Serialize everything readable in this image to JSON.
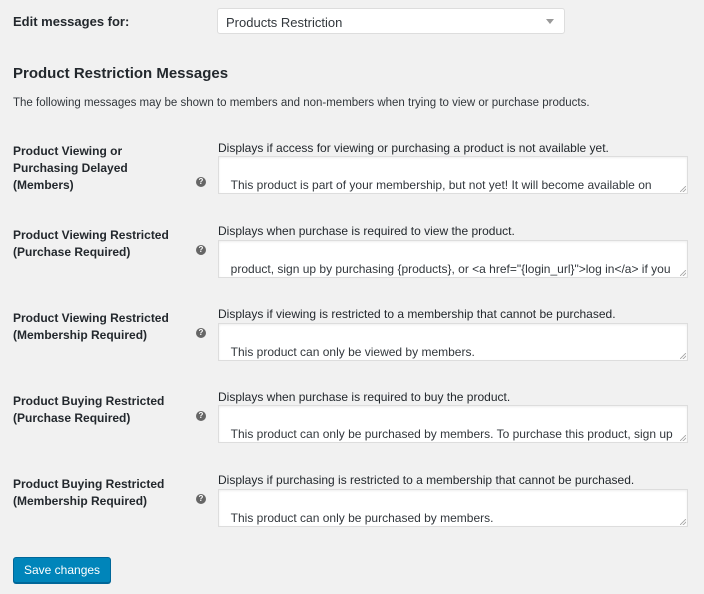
{
  "edit_for": {
    "label": "Edit messages for:",
    "selected": "Products Restriction"
  },
  "section": {
    "title": "Product Restriction Messages",
    "intro": "The following messages may be shown to members and non-members when trying to view or purchase products."
  },
  "help_icon_glyph": "?",
  "rows": [
    {
      "label": "Product Viewing or Purchasing Delayed (Members)",
      "description": "Displays if access for viewing or purchasing a product is not available yet.",
      "value": "This product is part of your membership, but not yet! It will become available on {date}."
    },
    {
      "label": "Product Viewing Restricted (Purchase Required)",
      "description": "Displays when purchase is required to view the product.",
      "value": "product, sign up by purchasing {products}, or <a href=\"{login_url}\">log in</a> if you are a member."
    },
    {
      "label": "Product Viewing Restricted (Membership Required)",
      "description": "Displays if viewing is restricted to a membership that cannot be purchased.",
      "value": "This product can only be viewed by members."
    },
    {
      "label": "Product Buying Restricted (Purchase Required)",
      "description": "Displays when purchase is required to buy the product.",
      "value": "This product can only be purchased by members. To purchase this product, sign up by purchasing {products}, or <a href=\"{login_url}\">log in</a> if you are"
    },
    {
      "label": "Product Buying Restricted (Membership Required)",
      "description": "Displays if purchasing is restricted to a membership that cannot be purchased.",
      "value": "This product can only be purchased by members."
    }
  ],
  "save_label": "Save changes",
  "colors": {
    "primary_button": "#0085ba",
    "background": "#f1f1f1"
  }
}
